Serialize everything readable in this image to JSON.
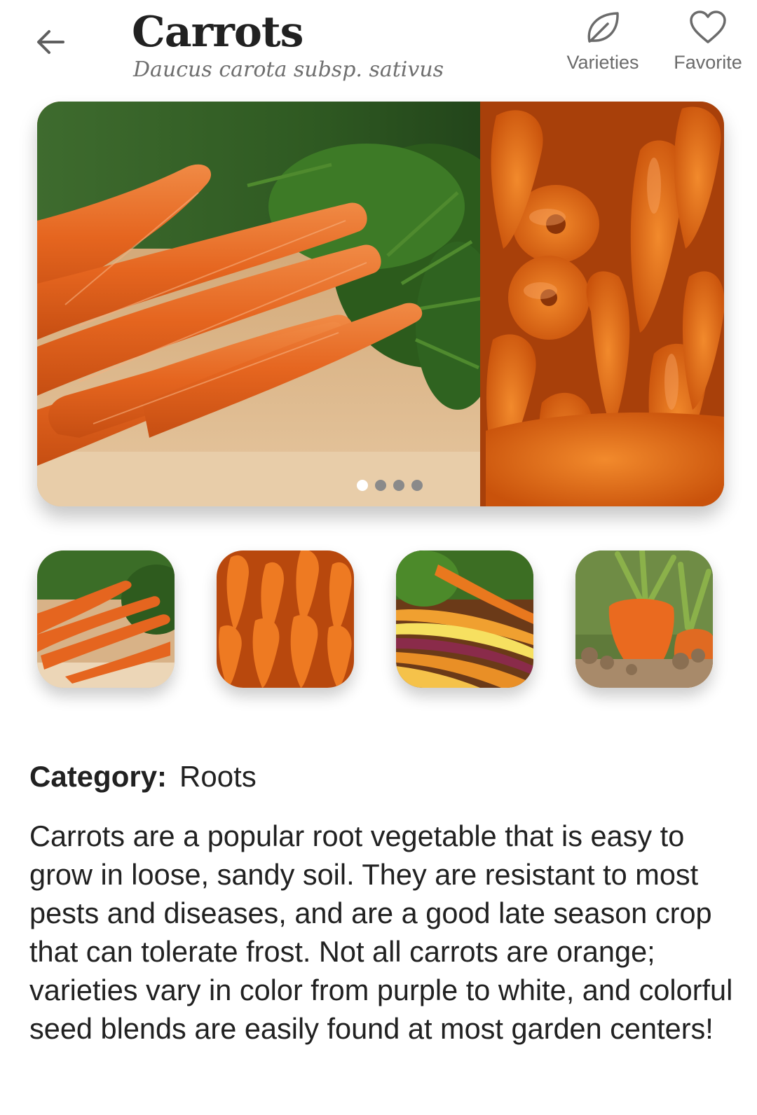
{
  "header": {
    "title": "Carrots",
    "subtitle": "Daucus carota subsp. sativus",
    "back_icon": "arrow-left-icon",
    "actions": [
      {
        "label": "Varieties",
        "icon": "leaf-icon"
      },
      {
        "label": "Favorite",
        "icon": "heart-outline-icon"
      }
    ]
  },
  "carousel": {
    "images": [
      "carrots-on-board-photo",
      "orange-carrots-pile-photo"
    ],
    "page_count": 4,
    "active_page": 1
  },
  "thumbnails": [
    {
      "name": "carrots-bunch-thumbnail"
    },
    {
      "name": "carrots-pile-thumbnail"
    },
    {
      "name": "colorful-carrots-thumbnail"
    },
    {
      "name": "carrot-in-soil-thumbnail"
    }
  ],
  "info": {
    "category_label": "Category:",
    "category_value": "Roots",
    "description": "Carrots are a popular root vegetable that is easy to grow in loose, sandy soil. They are resistant to most pests and diseases, and are a good late season crop that can tolerate frost. Not all carrots are orange; varieties vary in color from purple to white, and colorful seed blends are easily found at most garden centers!"
  },
  "colors": {
    "text": "#212121",
    "muted": "#6f6f6f",
    "carrot_orange": "#e8641e",
    "foliage_green": "#3f7a24"
  }
}
